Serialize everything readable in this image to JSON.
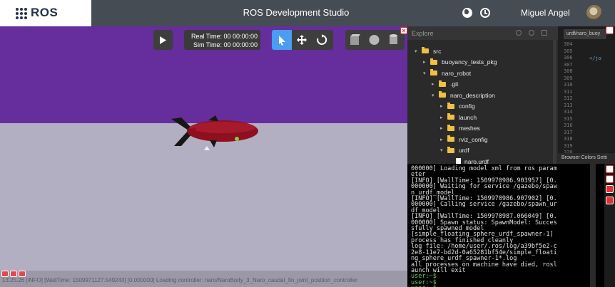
{
  "header": {
    "logo_text": "ROS",
    "title": "ROS Development Studio",
    "user_name": "Miguel Angel"
  },
  "viewport": {
    "real_time": "Real Time: 00 00:00:00",
    "sim_time": "Sim Time: 00 00:00:00",
    "status_text": "13:25:26 [INFO] [WallTime: 1509971127.549243] [0.000000] Loading controller: naro/NaroBody_3_Naro_caudal_fin_joint_position_controller",
    "colors": {
      "sky": "#662e9c",
      "floor": "#b3afc2"
    }
  },
  "explorer": {
    "title": "Explore",
    "tree": [
      {
        "label": "src",
        "indent": 0,
        "kind": "folder",
        "expanded": true
      },
      {
        "label": "buoyancy_tests_pkg",
        "indent": 1,
        "kind": "folder",
        "expanded": false
      },
      {
        "label": "naro_robot",
        "indent": 1,
        "kind": "folder",
        "expanded": true
      },
      {
        "label": ".git",
        "indent": 2,
        "kind": "folder",
        "expanded": false
      },
      {
        "label": "naro_description",
        "indent": 2,
        "kind": "folder",
        "expanded": true
      },
      {
        "label": "config",
        "indent": 3,
        "kind": "folder",
        "expanded": false
      },
      {
        "label": "launch",
        "indent": 3,
        "kind": "folder",
        "expanded": false
      },
      {
        "label": "meshes",
        "indent": 3,
        "kind": "folder",
        "expanded": false
      },
      {
        "label": "rviz_config",
        "indent": 3,
        "kind": "folder",
        "expanded": false
      },
      {
        "label": "urdf",
        "indent": 3,
        "kind": "folder",
        "expanded": true
      },
      {
        "label": "naro.urdf",
        "indent": 4,
        "kind": "file",
        "expanded": false
      }
    ]
  },
  "editor": {
    "tab_label": "urdf/naro_buoy",
    "line_numbers": [
      "304",
      "305",
      "306",
      "307",
      "308",
      "309",
      "310",
      "311",
      "312",
      "313",
      "314",
      "315",
      "316",
      "317",
      "318",
      "319",
      "320"
    ],
    "code_snippet": "</jo",
    "footer": "Browser  Colors  Setti"
  },
  "terminal": {
    "lines": [
      "000000] Loading model xml from ros param",
      "eter",
      "[INFO] [WallTime: 1509970986.903957] [0.",
      "000000] Waiting for service /gazebo/spaw",
      "n_urdf_model",
      "[INFO] [WallTime: 1509970986.907902] [0.",
      "000000] Calling service /gazebo/spawn_ur",
      "df_model",
      "[INFO] [WallTime: 1509970987.066049] [0.",
      "000000] Spawn status: SpawnModel: Succes",
      "sfully spawned model",
      "[simple_floating_sphere_urdf_spawner-1]",
      "process has finished cleanly",
      "log file: /home/user/.ros/log/a39bf5e2-c",
      "2e8-11e7-bd2d-0a65281bf54e/simple_floati",
      "ng_sphere_urdf_spawner-1*.log",
      "all processes on machine have died, rosl",
      "aunch will exit"
    ],
    "prompts": [
      "user:~$",
      "user:~$",
      "user:~$"
    ]
  }
}
